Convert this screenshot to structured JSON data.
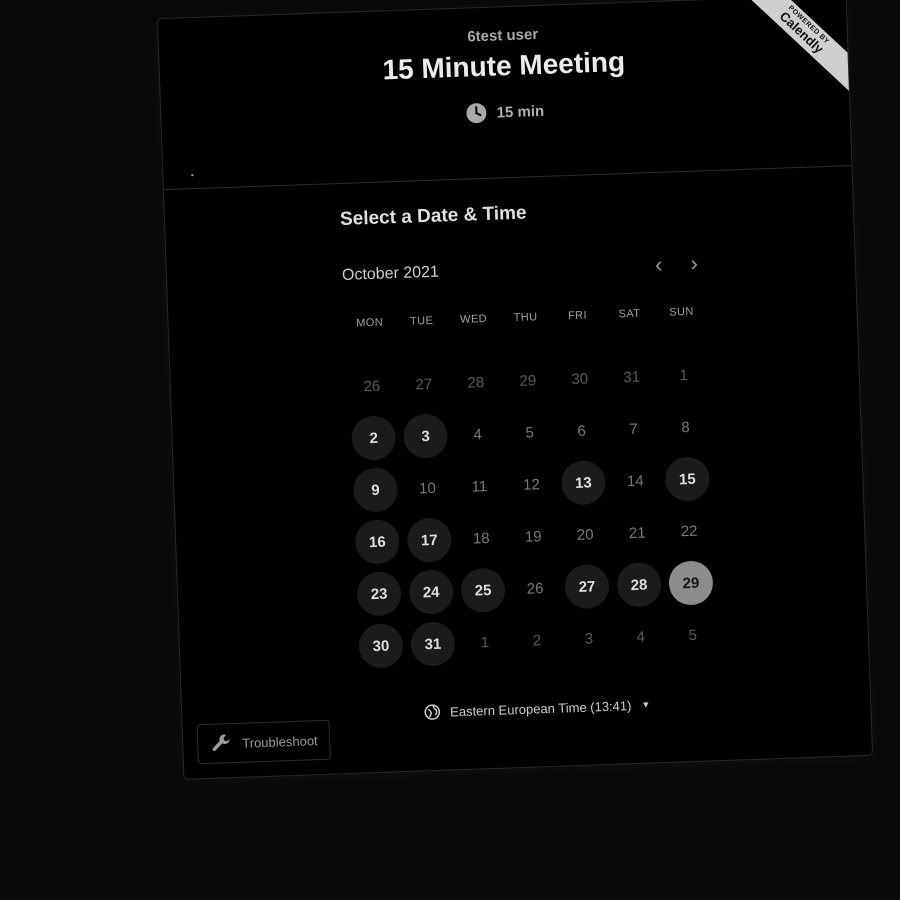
{
  "ribbon": {
    "small": "POWERED BY",
    "brand": "Calendly"
  },
  "header": {
    "host": "6test user",
    "title": "15 Minute Meeting",
    "duration": "15 min"
  },
  "picker": {
    "title": "Select a Date & Time",
    "month": "October 2021",
    "prev_icon": "chevron-left-icon",
    "next_icon": "chevron-right-icon",
    "weekdays": [
      "MON",
      "TUE",
      "WED",
      "THU",
      "FRI",
      "SAT",
      "SUN"
    ],
    "days": [
      {
        "n": "26",
        "s": "muted"
      },
      {
        "n": "27",
        "s": "muted"
      },
      {
        "n": "28",
        "s": "muted"
      },
      {
        "n": "29",
        "s": "muted"
      },
      {
        "n": "30",
        "s": "muted"
      },
      {
        "n": "31",
        "s": "muted"
      },
      {
        "n": "1",
        "s": "muted"
      },
      {
        "n": "2",
        "s": "avail"
      },
      {
        "n": "3",
        "s": "avail"
      },
      {
        "n": "4",
        "s": "off"
      },
      {
        "n": "5",
        "s": "off"
      },
      {
        "n": "6",
        "s": "off"
      },
      {
        "n": "7",
        "s": "off"
      },
      {
        "n": "8",
        "s": "off"
      },
      {
        "n": "9",
        "s": "avail"
      },
      {
        "n": "10",
        "s": "off"
      },
      {
        "n": "11",
        "s": "off"
      },
      {
        "n": "12",
        "s": "off"
      },
      {
        "n": "13",
        "s": "avail"
      },
      {
        "n": "14",
        "s": "off"
      },
      {
        "n": "15",
        "s": "avail"
      },
      {
        "n": "16",
        "s": "avail"
      },
      {
        "n": "17",
        "s": "avail"
      },
      {
        "n": "18",
        "s": "off"
      },
      {
        "n": "19",
        "s": "off"
      },
      {
        "n": "20",
        "s": "off"
      },
      {
        "n": "21",
        "s": "off"
      },
      {
        "n": "22",
        "s": "off"
      },
      {
        "n": "23",
        "s": "avail"
      },
      {
        "n": "24",
        "s": "avail"
      },
      {
        "n": "25",
        "s": "avail"
      },
      {
        "n": "26",
        "s": "off"
      },
      {
        "n": "27",
        "s": "avail"
      },
      {
        "n": "28",
        "s": "avail"
      },
      {
        "n": "29",
        "s": "selected"
      },
      {
        "n": "30",
        "s": "avail"
      },
      {
        "n": "31",
        "s": "avail"
      },
      {
        "n": "1",
        "s": "muted"
      },
      {
        "n": "2",
        "s": "muted"
      },
      {
        "n": "3",
        "s": "muted"
      },
      {
        "n": "4",
        "s": "muted"
      },
      {
        "n": "5",
        "s": "muted"
      }
    ],
    "timezone": "Eastern European Time (13:41)"
  },
  "troubleshoot": {
    "label": "Troubleshoot",
    "icon": "wrench-icon"
  },
  "colors": {
    "background": "#080808",
    "panel": "#000000",
    "available_day": "#1b1b1b",
    "selected_day": "#8c8c8c"
  }
}
